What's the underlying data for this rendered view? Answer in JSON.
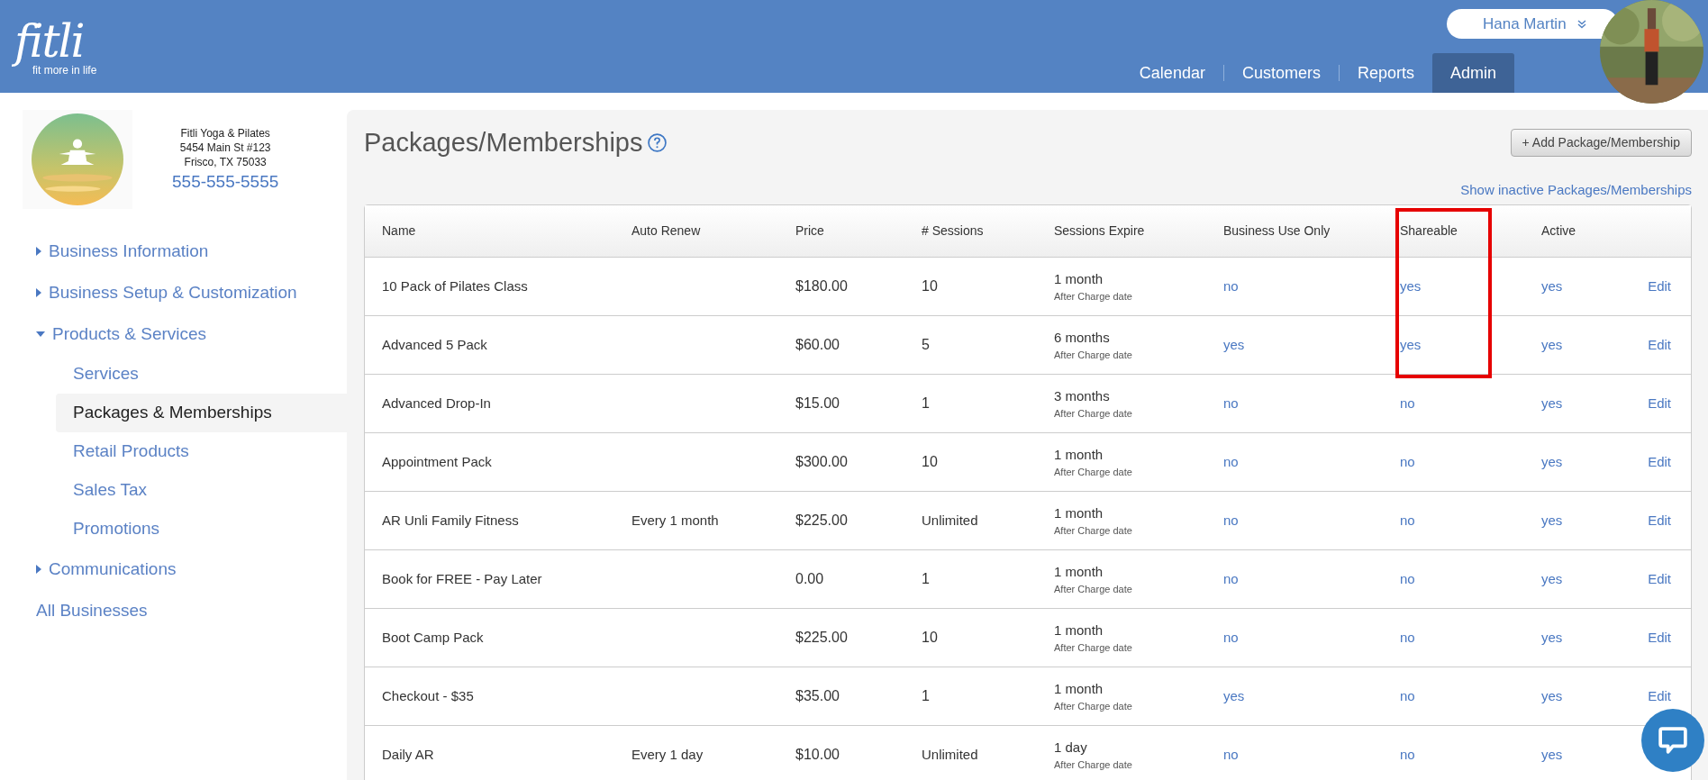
{
  "header": {
    "logo": "fitli",
    "tagline": "fit more in life",
    "nav": [
      {
        "label": "Calendar",
        "selected": false
      },
      {
        "label": "Customers",
        "selected": false
      },
      {
        "label": "Reports",
        "selected": false
      },
      {
        "label": "Admin",
        "selected": true
      }
    ],
    "user": {
      "name": "Hana Martin"
    }
  },
  "sidebar": {
    "business": {
      "name": "Fitli Yoga & Pilates",
      "address": "5454 Main St #123",
      "city": "Frisco, TX 75033",
      "phone": "555-555-5555"
    },
    "nav": [
      {
        "label": "Business Information",
        "kind": "section",
        "expanded": false
      },
      {
        "label": "Business Setup & Customization",
        "kind": "section",
        "expanded": false
      },
      {
        "label": "Products & Services",
        "kind": "section",
        "expanded": true,
        "children": [
          {
            "label": "Services",
            "selected": false
          },
          {
            "label": "Packages & Memberships",
            "selected": true
          },
          {
            "label": "Retail Products",
            "selected": false
          },
          {
            "label": "Sales Tax",
            "selected": false
          },
          {
            "label": "Promotions",
            "selected": false
          }
        ]
      },
      {
        "label": "Communications",
        "kind": "section",
        "expanded": false
      },
      {
        "label": "All Businesses",
        "kind": "link"
      }
    ]
  },
  "page": {
    "title": "Packages/Memberships",
    "add_button": "+ Add Package/Membership",
    "inactive_link": "Show inactive Packages/Memberships",
    "table": {
      "columns": [
        {
          "label": "Name",
          "highlighted": false
        },
        {
          "label": "Auto Renew",
          "highlighted": false
        },
        {
          "label": "Price",
          "highlighted": false
        },
        {
          "label": "# Sessions",
          "highlighted": false
        },
        {
          "label": "Sessions Expire",
          "highlighted": false
        },
        {
          "label": "Business Use Only",
          "highlighted": false
        },
        {
          "label": "Shareable",
          "highlighted": true
        },
        {
          "label": "Active",
          "highlighted": false
        }
      ],
      "rows": [
        {
          "name": "10 Pack of Pilates Class",
          "price": "$180.00",
          "sessions": "10",
          "expire": "1 month",
          "expire_note": "After Charge date",
          "business_use": "no",
          "shareable": "yes",
          "active": "yes",
          "edit": "Edit"
        },
        {
          "name": "Advanced 5 Pack",
          "price": "$60.00",
          "sessions": "5",
          "expire": "6 months",
          "expire_note": "After Charge date",
          "business_use": "yes",
          "shareable": "yes",
          "active": "yes",
          "edit": "Edit"
        },
        {
          "name": "Advanced Drop-In",
          "price": "$15.00",
          "sessions": "1",
          "expire": "3 months",
          "expire_note": "After Charge date",
          "business_use": "no",
          "shareable": "no",
          "active": "yes",
          "edit": "Edit"
        },
        {
          "name": "Appointment Pack",
          "price": "$300.00",
          "sessions": "10",
          "expire": "1 month",
          "expire_note": "After Charge date",
          "business_use": "no",
          "shareable": "no",
          "active": "yes",
          "edit": "Edit"
        },
        {
          "name": "AR Unli Family Fitness",
          "auto_renew": "Every 1 month",
          "price": "$225.00",
          "sessions": "Unlimited",
          "expire": "1 month",
          "expire_note": "After Charge date",
          "business_use": "no",
          "shareable": "no",
          "active": "yes",
          "edit": "Edit"
        },
        {
          "name": "Book for FREE - Pay Later",
          "price": "0.00",
          "sessions": "1",
          "expire": "1 month",
          "expire_note": "After Charge date",
          "business_use": "no",
          "shareable": "no",
          "active": "yes",
          "edit": "Edit"
        },
        {
          "name": "Boot Camp Pack",
          "price": "$225.00",
          "sessions": "10",
          "expire": "1 month",
          "expire_note": "After Charge date",
          "business_use": "no",
          "shareable": "no",
          "active": "yes",
          "edit": "Edit"
        },
        {
          "name": "Checkout - $35",
          "price": "$35.00",
          "sessions": "1",
          "expire": "1 month",
          "expire_note": "After Charge date",
          "business_use": "yes",
          "shareable": "no",
          "active": "yes",
          "edit": "Edit"
        },
        {
          "name": "Daily AR",
          "auto_renew": "Every 1 day",
          "price": "$10.00",
          "sessions": "Unlimited",
          "expire": "1 day",
          "expire_note": "After Charge date",
          "business_use": "no",
          "shareable": "no",
          "active": "yes"
        }
      ]
    }
  }
}
